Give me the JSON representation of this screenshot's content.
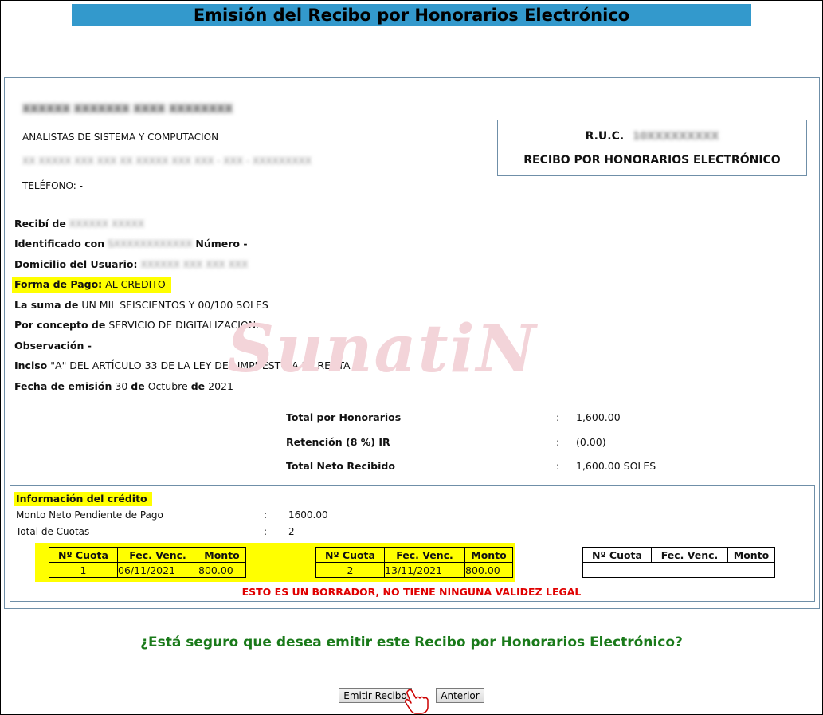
{
  "header": {
    "title": "Emisión del Recibo por Honorarios Electrónico"
  },
  "issuer": {
    "name": "XXXXXX XXXXXXX XXXX XXXXXXXX",
    "profession": "ANALISTAS DE SISTEMA Y COMPUTACION",
    "address": "XX XXXXX XXX XXX XX XXXXX XXX XXX - XXX - XXXXXXXXX",
    "phone_label": "TELÉFONO: -"
  },
  "ruc_box": {
    "ruc_label": "R.U.C.",
    "ruc_value": "10XXXXXXXXX",
    "doc_type": "RECIBO POR HONORARIOS ELECTRÓNICO"
  },
  "receipt": {
    "recibi_label": "Recibí de",
    "recibi_value": "XXXXXX XXXXX",
    "id_label": "Identificado con",
    "id_value": "SXXXXXXXXXXXX",
    "numero_label": "Número -",
    "domicilio_label": "Domicilio del Usuario:",
    "domicilio_value": "XXXXXX XXX XXX XXX",
    "forma_pago_label": "Forma de Pago:",
    "forma_pago_value": "AL CREDITO",
    "suma_label": "La suma de",
    "suma_value": "UN MIL SEISCIENTOS Y 00/100 SOLES",
    "concepto_label": "Por concepto de",
    "concepto_value": "SERVICIO DE DIGITALIZACION.",
    "observacion_label": "Observación -",
    "inciso_label": "Inciso",
    "inciso_value": "\"A\" DEL ARTÍCULO 33 DE LA LEY DEL IMPUESTO A LA RENTA",
    "fecha_label": "Fecha de emisión",
    "fecha_day": "30",
    "fecha_de": "de",
    "fecha_month": "Octubre",
    "fecha_year": "2021"
  },
  "watermark": "SunatiN",
  "totals": [
    {
      "label": "Total por Honorarios",
      "colon": ":",
      "value": "1,600.00"
    },
    {
      "label": "Retención (8 %) IR",
      "colon": ":",
      "value": "(0.00)"
    },
    {
      "label": "Total Neto Recibido",
      "colon": ":",
      "value": "1,600.00 SOLES"
    }
  ],
  "credit": {
    "title": "Información del crédito",
    "monto_label": "Monto Neto Pendiente de Pago",
    "monto_colon": ":",
    "monto_value": "1600.00",
    "cuotas_label": "Total de Cuotas",
    "cuotas_colon": ":",
    "cuotas_value": "2",
    "headers": [
      "Nº Cuota",
      "Fec. Venc.",
      "Monto"
    ],
    "installments": [
      {
        "n": "1",
        "date": "06/11/2021",
        "amount": "800.00"
      },
      {
        "n": "2",
        "date": "13/11/2021",
        "amount": "800.00"
      }
    ]
  },
  "warning": "ESTO ES UN BORRADOR, NO TIENE NINGUNA VALIDEZ LEGAL",
  "question": "¿Está seguro que desea emitir este Recibo por Honorarios Electrónico?",
  "buttons": {
    "emit": "Emitir Recibo",
    "back": "Anterior"
  },
  "colors": {
    "title_bar": "#3399cc",
    "highlight": "#ffff00",
    "warning": "#e00000",
    "question": "#1a7a1a"
  }
}
